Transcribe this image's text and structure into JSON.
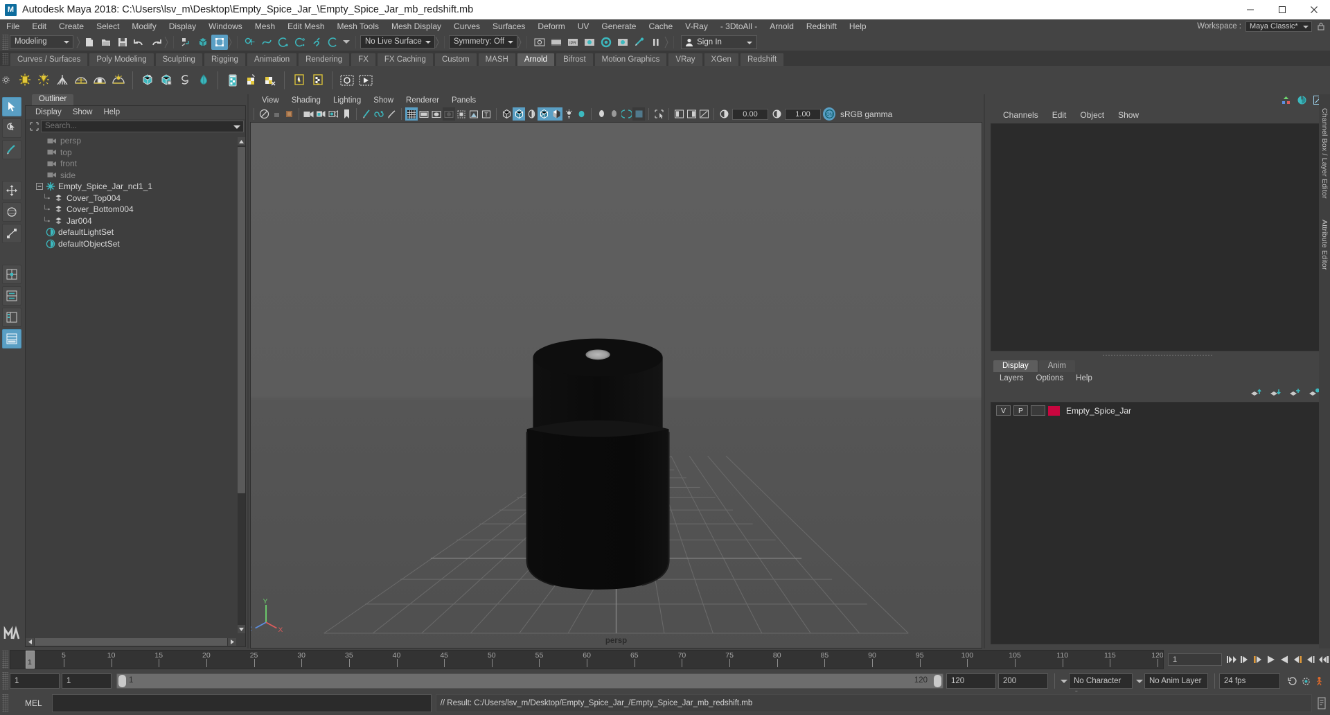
{
  "window": {
    "title": "Autodesk Maya 2018: C:\\Users\\lsv_m\\Desktop\\Empty_Spice_Jar_\\Empty_Spice_Jar_mb_redshift.mb",
    "logo_text": "M",
    "minimize": "–",
    "maximize": "□",
    "close": "✕"
  },
  "menubar": {
    "items": [
      "File",
      "Edit",
      "Create",
      "Select",
      "Modify",
      "Display",
      "Windows",
      "Mesh",
      "Edit Mesh",
      "Mesh Tools",
      "Mesh Display",
      "Curves",
      "Surfaces",
      "Deform",
      "UV",
      "Generate",
      "Cache",
      "V-Ray",
      "- 3DtoAll -",
      "Arnold",
      "Redshift",
      "Help"
    ],
    "workspace_label": "Workspace :",
    "workspace_value": "Maya Classic*",
    "lock_icon": "lock-icon"
  },
  "statusline": {
    "menu_set": "Modeling",
    "live_surface": "No Live Surface",
    "symmetry": "Symmetry: Off",
    "signin": "Sign In",
    "icons": [
      "new-scene-icon",
      "open-scene-icon",
      "save-scene-icon",
      "undo-icon",
      "redo-icon",
      "select-by-hierarchy-icon",
      "select-by-object-icon",
      "select-by-component-icon",
      "snap-to-grid-icon",
      "snap-to-curve-icon",
      "snap-to-point-icon",
      "snap-to-projected-center-icon",
      "snap-to-view-plane-icon",
      "make-live-icon",
      "render-view-icon",
      "render-current-frame-icon",
      "ipr-render-icon",
      "render-settings-icon",
      "hypershade-icon",
      "render-sequence-icon",
      "light-render-icon",
      "pause-render-icon"
    ]
  },
  "shelf": {
    "tabs": [
      "Curves / Surfaces",
      "Poly Modeling",
      "Sculpting",
      "Rigging",
      "Animation",
      "Rendering",
      "FX",
      "FX Caching",
      "Custom",
      "MASH",
      "Arnold",
      "Bifrost",
      "Motion Graphics",
      "VRay",
      "XGen",
      "Redshift"
    ],
    "active_tab": "Arnold",
    "icons": [
      "arnold-area-light-icon",
      "arnold-point-light-icon",
      "arnold-distant-light-icon",
      "arnold-skydome-light-icon",
      "arnold-mesh-light-icon",
      "arnold-photometric-light-icon",
      "arnold-standin-create-icon",
      "arnold-standin-export-icon",
      "arnold-volume-icon",
      "arnold-sky-icon",
      "arnold-render-icon",
      "arnold-assign-shader-icon",
      "arnold-remove-shader-icon",
      "arnold-flush-caches-icon",
      "arnold-tx-manager-icon",
      "arnold-open-render-view-icon",
      "arnold-play-sequence-icon"
    ]
  },
  "toolbox": {
    "tools": [
      "select-tool-icon",
      "lasso-select-tool-icon",
      "paint-select-tool-icon",
      "move-tool-icon",
      "rotate-tool-icon",
      "scale-tool-icon",
      "last-tool-icon",
      "layout-single-icon",
      "layout-four-view-icon",
      "layout-persp-outliner-icon",
      "layout-hypershade-icon"
    ],
    "logo": "maya-logo-icon"
  },
  "outliner": {
    "tab": "Outliner",
    "menus": [
      "Display",
      "Show",
      "Help"
    ],
    "search_placeholder": "Search...",
    "search_value": "",
    "items": [
      {
        "label": "persp",
        "icon": "camera-icon",
        "indent": 1,
        "dim": true,
        "expander": ""
      },
      {
        "label": "top",
        "icon": "camera-icon",
        "indent": 1,
        "dim": true,
        "expander": ""
      },
      {
        "label": "front",
        "icon": "camera-icon",
        "indent": 1,
        "dim": true,
        "expander": ""
      },
      {
        "label": "side",
        "icon": "camera-icon",
        "indent": 1,
        "dim": true,
        "expander": ""
      },
      {
        "label": "Empty_Spice_Jar_ncl1_1",
        "icon": "group-icon",
        "indent": 0,
        "dim": false,
        "expander": "minus"
      },
      {
        "label": "Cover_Top004",
        "icon": "mesh-icon",
        "indent": 2,
        "dim": false,
        "expander": "child"
      },
      {
        "label": "Cover_Bottom004",
        "icon": "mesh-icon",
        "indent": 2,
        "dim": false,
        "expander": "child"
      },
      {
        "label": "Jar004",
        "icon": "mesh-icon",
        "indent": 2,
        "dim": false,
        "expander": "childlast"
      },
      {
        "label": "defaultLightSet",
        "icon": "set-icon",
        "indent": 1,
        "dim": false,
        "expander": ""
      },
      {
        "label": "defaultObjectSet",
        "icon": "set-icon",
        "indent": 1,
        "dim": false,
        "expander": ""
      }
    ]
  },
  "viewport": {
    "menus": [
      "View",
      "Shading",
      "Lighting",
      "Show",
      "Renderer",
      "Panels"
    ],
    "camera_label": "persp",
    "exposure": "0.00",
    "gamma_value": "1.00",
    "color_management": "sRGB gamma",
    "axis_labels": {
      "y": "Y",
      "x": "X",
      "z": "Z"
    },
    "toolbar_icons": [
      "select-camera-icon",
      "lock-camera-icon",
      "camera-attributes-icon",
      "bookmark-icon",
      "image-plane-icon",
      "two-sided-lighting-icon",
      "shadows-icon",
      "grid-icon",
      "film-gate-icon",
      "resolution-gate-icon",
      "gate-mask-icon",
      "xray-icon",
      "xray-joints-icon",
      "texture-icon",
      "wireframe-icon",
      "smooth-shade-icon",
      "flat-shade-icon",
      "wireframe-on-shaded-icon",
      "texture-display-icon",
      "use-default-light-icon",
      "use-all-lights-icon",
      "shadow-map-icon",
      "ambient-occlusion-icon",
      "motion-blur-icon",
      "isolate-select-icon",
      "panel-zoom-icon",
      "grab-screenshot-icon",
      "exposure-icon",
      "gamma-icon",
      "view-transform-icon"
    ]
  },
  "channelbox": {
    "menus": [
      "Channels",
      "Edit",
      "Object",
      "Show"
    ],
    "header_icons": [
      "channel-box-icon",
      "attribute-editor-icon",
      "tool-settings-icon"
    ],
    "rows": []
  },
  "layereditor": {
    "tabs": [
      "Display",
      "Anim"
    ],
    "active_tab": "Display",
    "menus": [
      "Layers",
      "Options",
      "Help"
    ],
    "buttons": [
      "move-layer-up-icon",
      "move-layer-down-icon",
      "new-layer-icon",
      "new-layer-from-selected-icon"
    ],
    "layers": [
      {
        "visibility": "V",
        "playback": "P",
        "shading": "",
        "color": "#c9063f",
        "name": "Empty_Spice_Jar"
      }
    ]
  },
  "vertical_tabs": [
    "Channel Box / Layer Editor",
    "Attribute Editor"
  ],
  "timeslider": {
    "current_frame": "1",
    "current_frame_field": "1",
    "ticks": [
      5,
      10,
      15,
      20,
      25,
      30,
      35,
      40,
      45,
      50,
      55,
      60,
      65,
      70,
      75,
      80,
      85,
      90,
      95,
      100,
      105,
      110,
      115,
      120
    ],
    "range_start": 1,
    "range_end": 120,
    "playback_buttons": [
      "go-to-start-icon",
      "step-back-frame-icon",
      "step-back-key-icon",
      "play-backwards-icon",
      "play-forwards-icon",
      "step-forward-key-icon",
      "step-forward-frame-icon",
      "go-to-end-icon"
    ]
  },
  "rangeslider": {
    "anim_start": "1",
    "range_start": "1",
    "slider_left_label": "1",
    "slider_right_label": "120",
    "range_end": "120",
    "anim_end": "200",
    "character_set": "No Character Set",
    "anim_layer": "No Anim Layer",
    "fps": "24 fps",
    "icons": [
      "auto-key-icon",
      "animation-preferences-icon",
      "character-icon"
    ]
  },
  "commandline": {
    "label": "MEL",
    "input_value": "",
    "result": "// Result: C:/Users/lsv_m/Desktop/Empty_Spice_Jar_/Empty_Spice_Jar_mb_redshift.mb",
    "help_icon": "help-line-icon"
  },
  "colors": {
    "accent": "#5a9fc4",
    "panel_bg": "#444444",
    "field_bg": "#2b2b2b",
    "viewport_bg": "#5a5a5a",
    "layer_color": "#c9063f",
    "arnold_yellow": "#d6c13a",
    "arnold_teal": "#3cb9bf"
  }
}
